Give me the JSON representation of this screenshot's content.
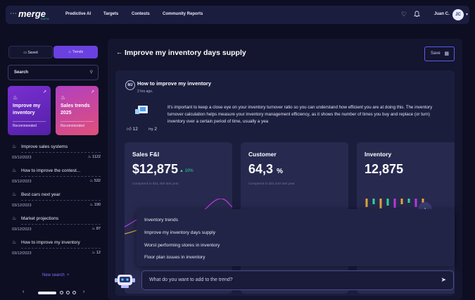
{
  "topbar": {
    "menu_icon": "ellipsis-icon",
    "logo_text": "merge",
    "logo_sub": "DATA",
    "nav": [
      "Predictive AI",
      "Targets",
      "Contests",
      "Community Reports"
    ],
    "heart_icon": "heart-icon",
    "bell_icon": "bell-icon",
    "user_name": "Juan C.",
    "avatar_initials": "JC"
  },
  "sidebar": {
    "tabs": [
      {
        "label": "Saved",
        "icon": "bookmark-icon"
      },
      {
        "label": "Trends",
        "icon": "flame-icon",
        "active": true
      }
    ],
    "search_label": "Search",
    "cards": [
      {
        "title": "Improve my inventory",
        "tag": "Recommended",
        "color": "#6a2ec7"
      },
      {
        "title": "Sales trends 2025",
        "tag": "Recommended",
        "color": "#c1447e"
      }
    ],
    "items": [
      {
        "title": "Improve sales systems",
        "date": "03/12/2023",
        "count": "1122"
      },
      {
        "title": "How to improve the contest...",
        "date": "03/12/2023",
        "count": "532"
      },
      {
        "title": "Best cars next year",
        "date": "03/12/2023",
        "count": "190"
      },
      {
        "title": "Market projections",
        "date": "03/12/2023",
        "count": "87"
      },
      {
        "title": "How to improve my inventory",
        "date": "03/12/2023",
        "count": "12"
      }
    ],
    "new_search": "New search",
    "pager_pages": 4,
    "pager_active": 1
  },
  "main": {
    "title": "Improve my inventory days supply",
    "save_label": "Save",
    "post": {
      "avatar": "MJ",
      "title": "How to improve my inventory",
      "time": "2 hrs ago.",
      "body": "It's important to keep a close eye on your inventory turnover ratio so you can understand how efficient you are at doing this. The inventory turnover calculation helps measure your inventory management efficiency, as it shows the number of times you buy and replace (or turn) inventory over a certain period of time, usually a yea",
      "likes": "12",
      "dislikes": "2"
    },
    "kpis": [
      {
        "title": "Sales F&I",
        "value": "$12,875",
        "delta": "10%",
        "compare": "Compared to $21,450 last year"
      },
      {
        "title": "Customer",
        "value": "64,3",
        "unit": "%",
        "compare": "Compared to $21,534 last year"
      },
      {
        "title": "Inventory",
        "value": "12,875"
      }
    ],
    "suggestions": [
      "Inventory trends",
      "Improve my inventory days supply",
      "Worst performing stores in inventory",
      "Floor plan issues in inventory"
    ],
    "chat_placeholder": "What do you want to add to the trend?",
    "accent": "#6a40e0",
    "positive": "#2fd59a"
  }
}
